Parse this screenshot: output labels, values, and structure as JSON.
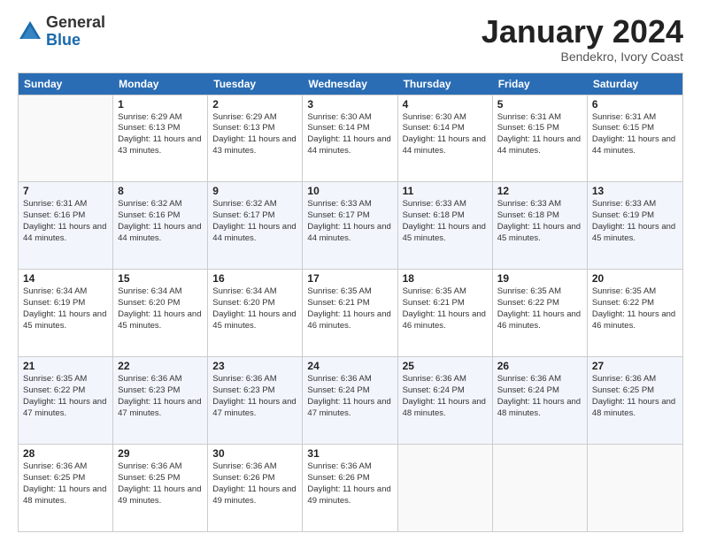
{
  "logo": {
    "general": "General",
    "blue": "Blue"
  },
  "title": {
    "month": "January 2024",
    "location": "Bendekro, Ivory Coast"
  },
  "calendar": {
    "days": [
      "Sunday",
      "Monday",
      "Tuesday",
      "Wednesday",
      "Thursday",
      "Friday",
      "Saturday"
    ],
    "rows": [
      [
        {
          "day": "",
          "sunrise": "",
          "sunset": "",
          "daylight": "",
          "empty": true
        },
        {
          "day": "1",
          "sunrise": "Sunrise: 6:29 AM",
          "sunset": "Sunset: 6:13 PM",
          "daylight": "Daylight: 11 hours and 43 minutes."
        },
        {
          "day": "2",
          "sunrise": "Sunrise: 6:29 AM",
          "sunset": "Sunset: 6:13 PM",
          "daylight": "Daylight: 11 hours and 43 minutes."
        },
        {
          "day": "3",
          "sunrise": "Sunrise: 6:30 AM",
          "sunset": "Sunset: 6:14 PM",
          "daylight": "Daylight: 11 hours and 44 minutes."
        },
        {
          "day": "4",
          "sunrise": "Sunrise: 6:30 AM",
          "sunset": "Sunset: 6:14 PM",
          "daylight": "Daylight: 11 hours and 44 minutes."
        },
        {
          "day": "5",
          "sunrise": "Sunrise: 6:31 AM",
          "sunset": "Sunset: 6:15 PM",
          "daylight": "Daylight: 11 hours and 44 minutes."
        },
        {
          "day": "6",
          "sunrise": "Sunrise: 6:31 AM",
          "sunset": "Sunset: 6:15 PM",
          "daylight": "Daylight: 11 hours and 44 minutes."
        }
      ],
      [
        {
          "day": "7",
          "sunrise": "Sunrise: 6:31 AM",
          "sunset": "Sunset: 6:16 PM",
          "daylight": "Daylight: 11 hours and 44 minutes."
        },
        {
          "day": "8",
          "sunrise": "Sunrise: 6:32 AM",
          "sunset": "Sunset: 6:16 PM",
          "daylight": "Daylight: 11 hours and 44 minutes."
        },
        {
          "day": "9",
          "sunrise": "Sunrise: 6:32 AM",
          "sunset": "Sunset: 6:17 PM",
          "daylight": "Daylight: 11 hours and 44 minutes."
        },
        {
          "day": "10",
          "sunrise": "Sunrise: 6:33 AM",
          "sunset": "Sunset: 6:17 PM",
          "daylight": "Daylight: 11 hours and 44 minutes."
        },
        {
          "day": "11",
          "sunrise": "Sunrise: 6:33 AM",
          "sunset": "Sunset: 6:18 PM",
          "daylight": "Daylight: 11 hours and 45 minutes."
        },
        {
          "day": "12",
          "sunrise": "Sunrise: 6:33 AM",
          "sunset": "Sunset: 6:18 PM",
          "daylight": "Daylight: 11 hours and 45 minutes."
        },
        {
          "day": "13",
          "sunrise": "Sunrise: 6:33 AM",
          "sunset": "Sunset: 6:19 PM",
          "daylight": "Daylight: 11 hours and 45 minutes."
        }
      ],
      [
        {
          "day": "14",
          "sunrise": "Sunrise: 6:34 AM",
          "sunset": "Sunset: 6:19 PM",
          "daylight": "Daylight: 11 hours and 45 minutes."
        },
        {
          "day": "15",
          "sunrise": "Sunrise: 6:34 AM",
          "sunset": "Sunset: 6:20 PM",
          "daylight": "Daylight: 11 hours and 45 minutes."
        },
        {
          "day": "16",
          "sunrise": "Sunrise: 6:34 AM",
          "sunset": "Sunset: 6:20 PM",
          "daylight": "Daylight: 11 hours and 45 minutes."
        },
        {
          "day": "17",
          "sunrise": "Sunrise: 6:35 AM",
          "sunset": "Sunset: 6:21 PM",
          "daylight": "Daylight: 11 hours and 46 minutes."
        },
        {
          "day": "18",
          "sunrise": "Sunrise: 6:35 AM",
          "sunset": "Sunset: 6:21 PM",
          "daylight": "Daylight: 11 hours and 46 minutes."
        },
        {
          "day": "19",
          "sunrise": "Sunrise: 6:35 AM",
          "sunset": "Sunset: 6:22 PM",
          "daylight": "Daylight: 11 hours and 46 minutes."
        },
        {
          "day": "20",
          "sunrise": "Sunrise: 6:35 AM",
          "sunset": "Sunset: 6:22 PM",
          "daylight": "Daylight: 11 hours and 46 minutes."
        }
      ],
      [
        {
          "day": "21",
          "sunrise": "Sunrise: 6:35 AM",
          "sunset": "Sunset: 6:22 PM",
          "daylight": "Daylight: 11 hours and 47 minutes."
        },
        {
          "day": "22",
          "sunrise": "Sunrise: 6:36 AM",
          "sunset": "Sunset: 6:23 PM",
          "daylight": "Daylight: 11 hours and 47 minutes."
        },
        {
          "day": "23",
          "sunrise": "Sunrise: 6:36 AM",
          "sunset": "Sunset: 6:23 PM",
          "daylight": "Daylight: 11 hours and 47 minutes."
        },
        {
          "day": "24",
          "sunrise": "Sunrise: 6:36 AM",
          "sunset": "Sunset: 6:24 PM",
          "daylight": "Daylight: 11 hours and 47 minutes."
        },
        {
          "day": "25",
          "sunrise": "Sunrise: 6:36 AM",
          "sunset": "Sunset: 6:24 PM",
          "daylight": "Daylight: 11 hours and 48 minutes."
        },
        {
          "day": "26",
          "sunrise": "Sunrise: 6:36 AM",
          "sunset": "Sunset: 6:24 PM",
          "daylight": "Daylight: 11 hours and 48 minutes."
        },
        {
          "day": "27",
          "sunrise": "Sunrise: 6:36 AM",
          "sunset": "Sunset: 6:25 PM",
          "daylight": "Daylight: 11 hours and 48 minutes."
        }
      ],
      [
        {
          "day": "28",
          "sunrise": "Sunrise: 6:36 AM",
          "sunset": "Sunset: 6:25 PM",
          "daylight": "Daylight: 11 hours and 48 minutes."
        },
        {
          "day": "29",
          "sunrise": "Sunrise: 6:36 AM",
          "sunset": "Sunset: 6:25 PM",
          "daylight": "Daylight: 11 hours and 49 minutes."
        },
        {
          "day": "30",
          "sunrise": "Sunrise: 6:36 AM",
          "sunset": "Sunset: 6:26 PM",
          "daylight": "Daylight: 11 hours and 49 minutes."
        },
        {
          "day": "31",
          "sunrise": "Sunrise: 6:36 AM",
          "sunset": "Sunset: 6:26 PM",
          "daylight": "Daylight: 11 hours and 49 minutes."
        },
        {
          "day": "",
          "sunrise": "",
          "sunset": "",
          "daylight": "",
          "empty": true
        },
        {
          "day": "",
          "sunrise": "",
          "sunset": "",
          "daylight": "",
          "empty": true
        },
        {
          "day": "",
          "sunrise": "",
          "sunset": "",
          "daylight": "",
          "empty": true
        }
      ]
    ]
  }
}
